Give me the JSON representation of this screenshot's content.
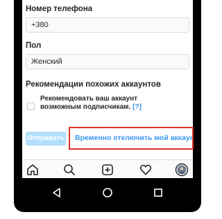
{
  "form": {
    "phone_label": "Номер телефона",
    "phone_value": "+380",
    "gender_label": "Пол",
    "gender_value": "Женский",
    "recommendations_label": "Рекомендации похожих аккаунтов",
    "recommend_checkbox_text": "Рекомендовать ваш аккаунт возможным подписчикам.",
    "help_link": "[?]",
    "recommend_checked": false
  },
  "actions": {
    "submit_label": "Отправить",
    "disable_account_label": "Временно отключить мой аккаунт"
  },
  "tabbar": {
    "icons": [
      "home-icon",
      "search-icon",
      "add-post-icon",
      "heart-icon",
      "profile-avatar"
    ]
  },
  "android_nav": {
    "icons": [
      "back-icon",
      "home-icon",
      "recents-icon"
    ]
  },
  "colors": {
    "accent": "#3897f0",
    "button_disabled": "#b2dffc",
    "highlight": "#e0302b"
  }
}
